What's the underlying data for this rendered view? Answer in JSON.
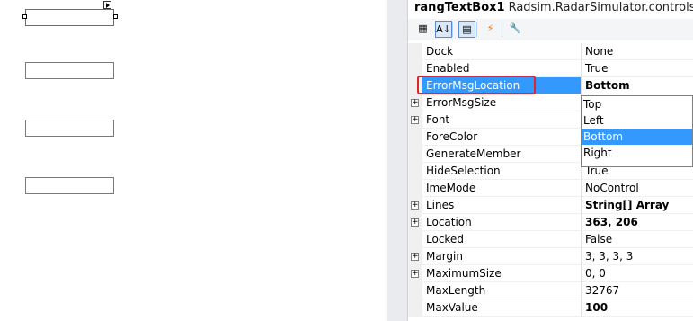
{
  "properties_panel": {
    "object_name": "rangTextBox1",
    "object_type": "Radsim.RadarSimulator.controls.Rang",
    "toolbar": [
      {
        "name": "categorized-icon",
        "glyph": "▦"
      },
      {
        "name": "alphabetical-icon",
        "glyph": "A↓"
      },
      {
        "name": "properties-icon",
        "glyph": "▤"
      },
      {
        "name": "events-icon",
        "glyph": "⚡"
      },
      {
        "name": "property-pages-icon",
        "glyph": "🔧"
      }
    ],
    "rows": [
      {
        "name": "Dock",
        "value": "None",
        "expandable": false,
        "bold": false,
        "selected": false
      },
      {
        "name": "Enabled",
        "value": "True",
        "expandable": false,
        "bold": false,
        "selected": false
      },
      {
        "name": "ErrorMsgLocation",
        "value": "Bottom",
        "expandable": false,
        "bold": true,
        "selected": true
      },
      {
        "name": "ErrorMsgSize",
        "value": "",
        "expandable": true,
        "bold": false,
        "selected": false
      },
      {
        "name": "Font",
        "value": "",
        "expandable": true,
        "bold": false,
        "selected": false
      },
      {
        "name": "ForeColor",
        "value": "",
        "expandable": false,
        "bold": false,
        "selected": false
      },
      {
        "name": "GenerateMember",
        "value": "",
        "expandable": false,
        "bold": false,
        "selected": false
      },
      {
        "name": "HideSelection",
        "value": "True",
        "expandable": false,
        "bold": false,
        "selected": false
      },
      {
        "name": "ImeMode",
        "value": "NoControl",
        "expandable": false,
        "bold": false,
        "selected": false
      },
      {
        "name": "Lines",
        "value": "String[] Array",
        "expandable": true,
        "bold": true,
        "selected": false
      },
      {
        "name": "Location",
        "value": "363, 206",
        "expandable": true,
        "bold": true,
        "selected": false
      },
      {
        "name": "Locked",
        "value": "False",
        "expandable": false,
        "bold": false,
        "selected": false
      },
      {
        "name": "Margin",
        "value": "3, 3, 3, 3",
        "expandable": true,
        "bold": false,
        "selected": false
      },
      {
        "name": "MaximumSize",
        "value": "0, 0",
        "expandable": true,
        "bold": false,
        "selected": false
      },
      {
        "name": "MaxLength",
        "value": "32767",
        "expandable": false,
        "bold": false,
        "selected": false
      },
      {
        "name": "MaxValue",
        "value": "100",
        "expandable": false,
        "bold": true,
        "selected": false
      }
    ],
    "dropdown": {
      "options": [
        "Top",
        "Left",
        "Bottom",
        "Right"
      ],
      "selected": "Bottom"
    }
  },
  "colors": {
    "selection": "#3399ff",
    "highlight_box": "#e0262b"
  }
}
